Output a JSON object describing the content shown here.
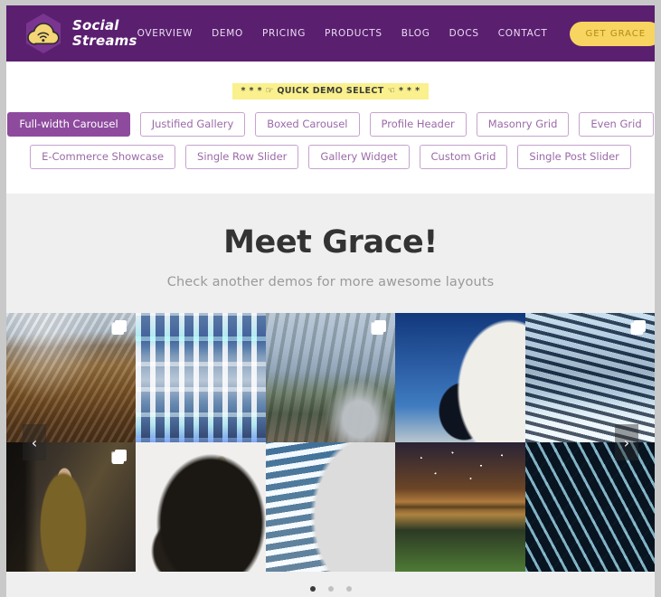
{
  "header": {
    "brand": {
      "line1": "Social",
      "line2": "Streams",
      "logo_icon": "cloud-wifi-icon"
    },
    "nav": [
      {
        "label": "OVERVIEW"
      },
      {
        "label": "DEMO"
      },
      {
        "label": "PRICING"
      },
      {
        "label": "PRODUCTS"
      },
      {
        "label": "BLOG"
      },
      {
        "label": "DOCS"
      },
      {
        "label": "CONTACT"
      }
    ],
    "cta_label": "GET GRACE",
    "bg_color": "#5b1f70",
    "cta_color": "#f7d560"
  },
  "demo_select": {
    "quick_label": "* * * ☞ QUICK DEMO SELECT ☜ * * *",
    "rows": [
      [
        {
          "label": "Full-width Carousel",
          "active": true
        },
        {
          "label": "Justified Gallery",
          "active": false
        },
        {
          "label": "Boxed Carousel",
          "active": false
        },
        {
          "label": "Profile Header",
          "active": false
        },
        {
          "label": "Masonry Grid",
          "active": false
        },
        {
          "label": "Even Grid",
          "active": false
        }
      ],
      [
        {
          "label": "E-Commerce Showcase",
          "active": false
        },
        {
          "label": "Single Row Slider",
          "active": false
        },
        {
          "label": "Gallery Widget",
          "active": false
        },
        {
          "label": "Custom Grid",
          "active": false
        },
        {
          "label": "Single Post Slider",
          "active": false
        }
      ]
    ],
    "accent_color": "#8e4b9e",
    "highlight_color": "#faf08d"
  },
  "hero": {
    "title": "Meet Grace!",
    "subtitle": "Check another demos for more awesome layouts",
    "bg_color": "#efefef"
  },
  "carousel": {
    "prev_label": "‹",
    "next_label": "›",
    "prev_icon": "chevron-left-icon",
    "next_icon": "chevron-right-icon",
    "badge_icon": "multiple-photos-icon",
    "tiles": [
      {
        "alt": "mountain canyon landscape",
        "art": "a-canyon",
        "badge": true
      },
      {
        "alt": "white geometric architecture facade",
        "art": "a-arch",
        "badge": false
      },
      {
        "alt": "pickup truck in the mountains",
        "art": "a-truck",
        "badge": true
      },
      {
        "alt": "white curved building with round windows",
        "art": "a-eyes",
        "badge": false
      },
      {
        "alt": "blue glacier ice cliff",
        "art": "a-glacier",
        "badge": true
      },
      {
        "alt": "person in elevator looking up",
        "art": "a-person",
        "badge": true
      },
      {
        "alt": "black and white bison portrait",
        "art": "a-bison",
        "badge": false
      },
      {
        "alt": "curved striped skyscraper",
        "art": "a-tower",
        "badge": false
      },
      {
        "alt": "milky way over a lake at dusk",
        "art": "a-milky",
        "badge": false
      },
      {
        "alt": "aerial river delta braids",
        "art": "a-delta",
        "badge": false
      }
    ],
    "dots": [
      {
        "active": true
      },
      {
        "active": false
      },
      {
        "active": false
      }
    ]
  }
}
